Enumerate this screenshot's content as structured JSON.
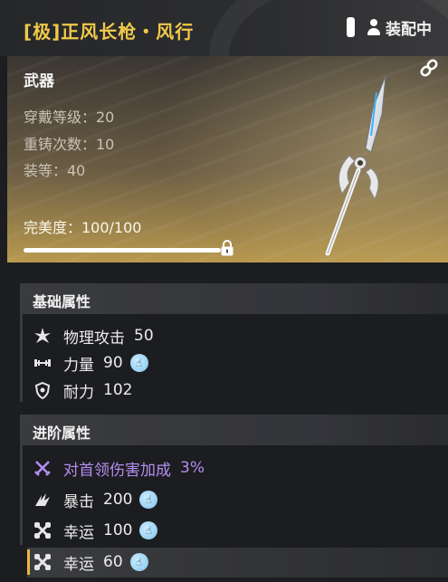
{
  "header": {
    "title": "[极]正风长枪・风行",
    "equip_status": "装配中"
  },
  "weapon": {
    "type": "武器",
    "stats": [
      {
        "label": "穿戴等级：20"
      },
      {
        "label": "重铸次数：10"
      },
      {
        "label": "装等：40"
      }
    ],
    "perfection": "完美度：100/100",
    "perfection_value": 100,
    "perfection_max": 100
  },
  "basic": {
    "title": "基础属性",
    "rows": [
      {
        "icon": "attack-burst-icon",
        "name": "物理攻击",
        "value": "50",
        "thumb": false
      },
      {
        "icon": "dumbbell-icon",
        "name": "力量",
        "value": "90",
        "thumb": true
      },
      {
        "icon": "shield-icon",
        "name": "耐力",
        "value": "102",
        "thumb": false
      }
    ]
  },
  "advanced": {
    "title": "进阶属性",
    "rows": [
      {
        "icon": "crossed-swords-icon",
        "name": "对首领伤害加成",
        "value": "3%",
        "thumb": false,
        "color": "#b48df0"
      },
      {
        "icon": "crit-claw-icon",
        "name": "暴击",
        "value": "200",
        "thumb": true
      },
      {
        "icon": "clover-icon",
        "name": "幸运",
        "value": "100",
        "thumb": true
      },
      {
        "icon": "clover-icon",
        "name": "幸运",
        "value": "60",
        "thumb": true
      }
    ]
  },
  "colors": {
    "title_gold": "#f0c94a",
    "accent_purple": "#b48df0",
    "thumb_blue": "#7cc3ea",
    "highlight_gold": "#e7b83e"
  }
}
